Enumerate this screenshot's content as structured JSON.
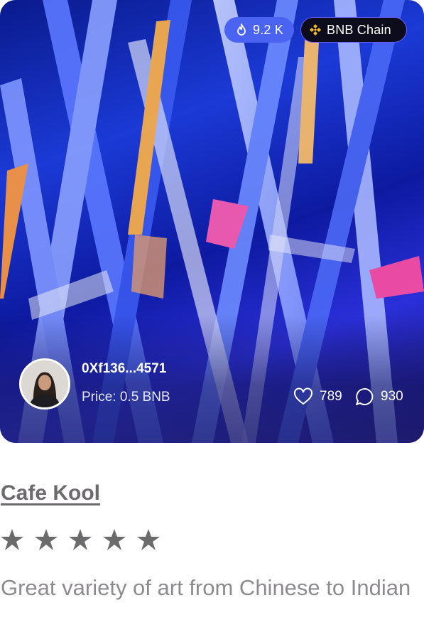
{
  "card": {
    "views_badge": "9.2 K",
    "chain_badge": "BNB Chain",
    "owner_address": "0Xf136...4571",
    "price": "Price: 0.5 BNB",
    "likes": "789",
    "comments": "930",
    "icons": {
      "views": "fire-icon",
      "chain": "bnb-logo-icon",
      "likes": "heart-icon",
      "comments": "comment-icon"
    },
    "colors": {
      "views_badge_bg": "#4a63f0",
      "chain_badge_bg": "#0c0c1c",
      "chain_badge_border": "#6a5cff"
    }
  },
  "details": {
    "title": "Cafe Kool",
    "rating": 5,
    "description": "Great variety of art from Chinese to Indian"
  }
}
